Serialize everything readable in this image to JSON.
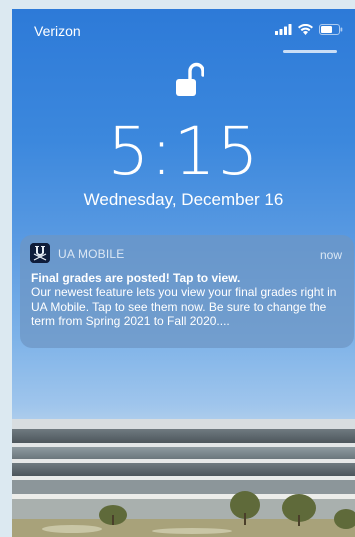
{
  "status_bar": {
    "carrier": "Verizon",
    "icons": [
      "signal-icon",
      "wifi-icon",
      "battery-icon"
    ]
  },
  "lock_screen": {
    "time": "5:15",
    "date": "Wednesday, December 16"
  },
  "notification": {
    "app_name": "UA MOBILE",
    "time": "now",
    "title": "Final grades are posted! Tap to view.",
    "body": "Our newest feature lets you view your final grades right in UA Mobile. Tap to see them now. Be sure to change the term from Spring 2021 to Fall 2020...."
  },
  "colors": {
    "sky_top": "#2d7ad8",
    "sky_bottom": "#b8d2ec",
    "notification_bg": "#6e96c3",
    "app_icon_bg": "#0f1d3b"
  }
}
